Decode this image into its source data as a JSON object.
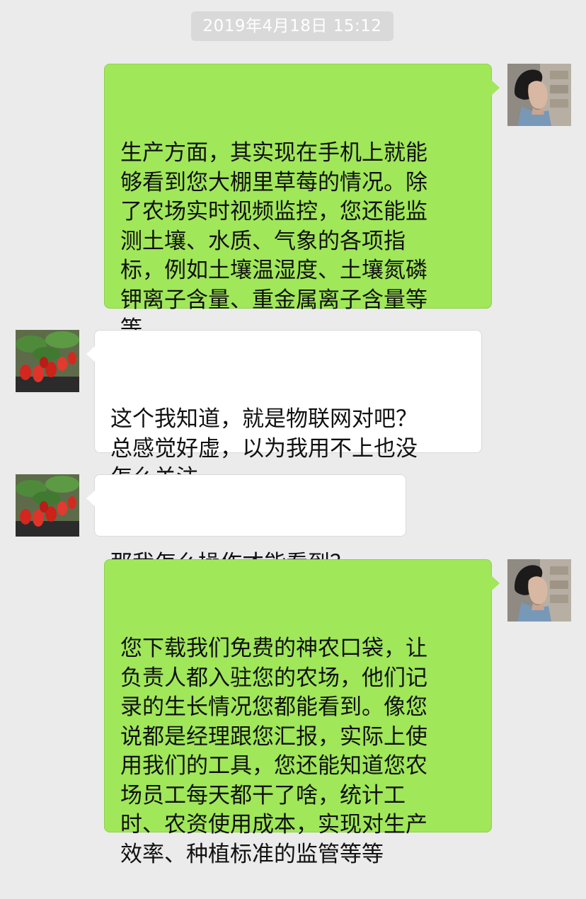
{
  "timestamp": "2019年4月18日 15:12",
  "colors": {
    "background": "#ebebeb",
    "outgoing_bubble": "#a0e75a",
    "incoming_bubble": "#ffffff",
    "timestamp_pill": "#d9d9d9"
  },
  "messages": [
    {
      "sender": "self",
      "avatar": "woman-profile-avatar",
      "text": "生产方面，其实现在手机上就能\n够看到您大棚里草莓的情况。除\n了农场实时视频监控，您还能监\n测土壤、水质、气象的各项指\n标，例如土壤温湿度、土壤氮磷\n钾离子含量、重金属离子含量等\n等"
    },
    {
      "sender": "other",
      "avatar": "strawberry-avatar",
      "text": "这个我知道，就是物联网对吧？\n总感觉好虚，以为我用不上也没\n怎么关注"
    },
    {
      "sender": "other",
      "avatar": "strawberry-avatar",
      "text": "那我怎么操作才能看到？"
    },
    {
      "sender": "self",
      "avatar": "woman-profile-avatar",
      "text": "您下载我们免费的神农口袋，让\n负责人都入驻您的农场，他们记\n录的生长情况您都能看到。像您\n说都是经理跟您汇报，实际上使\n用我们的工具，您还能知道您农\n场员工每天都干了啥，统计工\n时、农资使用成本，实现对生产\n效率、种植标准的监管等等"
    }
  ]
}
